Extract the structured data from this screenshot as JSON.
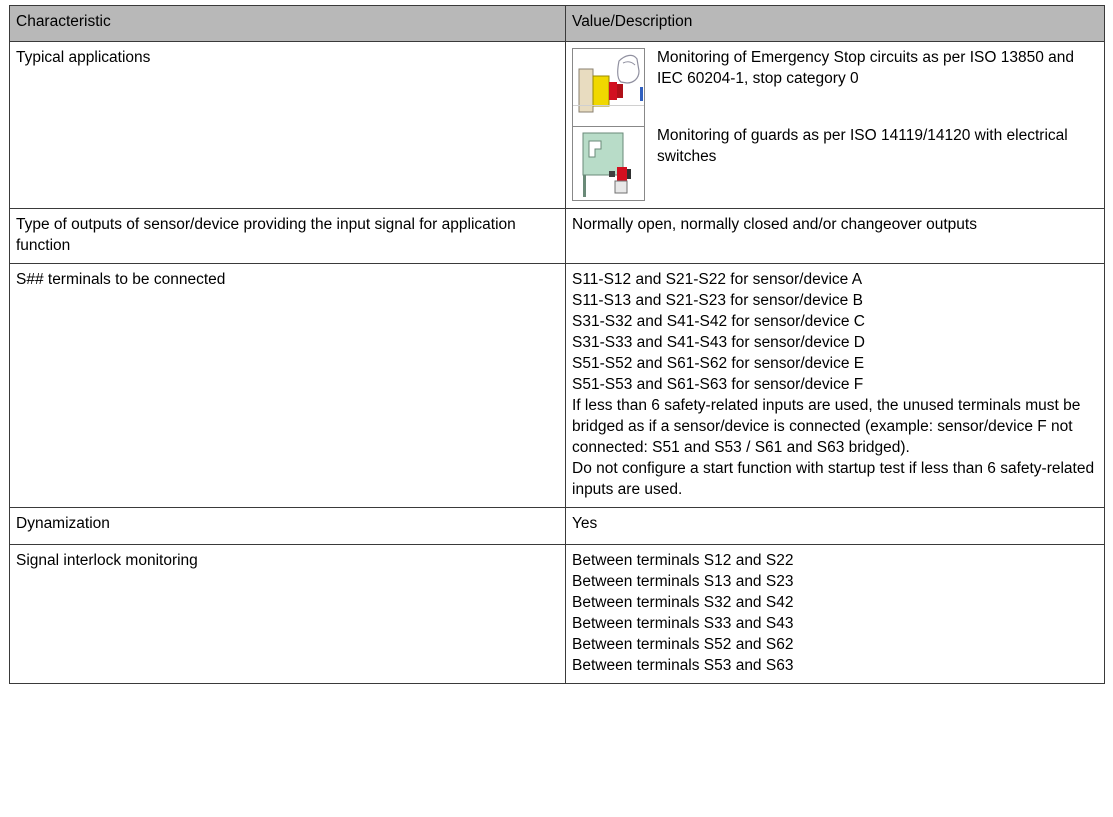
{
  "table": {
    "headers": [
      "Characteristic",
      "Value/Description"
    ],
    "rows": {
      "typical_applications": {
        "label": "Typical applications",
        "items": [
          {
            "icon": "emergency-stop-button-icon",
            "text": "Monitoring of Emergency Stop circuits as per ISO 13850 and IEC 60204-1, stop category 0"
          },
          {
            "icon": "guard-switch-icon",
            "text": "Monitoring of guards as per ISO 14119/14120 with electrical switches"
          }
        ]
      },
      "output_type": {
        "label": "Type of outputs of sensor/device providing the input signal for application function",
        "value": "Normally open, normally closed and/or changeover outputs"
      },
      "terminals": {
        "label": "S## terminals to be connected",
        "lines": [
          "S11-S12 and S21-S22 for sensor/device A",
          "S11-S13 and S21-S23 for sensor/device B",
          "S31-S32 and S41-S42 for sensor/device C",
          "S31-S33 and S41-S43 for sensor/device D",
          "S51-S52 and S61-S62 for sensor/device E",
          "S51-S53 and S61-S63 for sensor/device F",
          "If less than 6 safety-related inputs are used, the unused terminals must be bridged as if a sensor/device is connected (example: sensor/device F not connected: S51 and S53 / S61 and S63 bridged).",
          "Do not configure a start function with startup test if less than 6 safety-related inputs are used."
        ]
      },
      "dynamization": {
        "label": "Dynamization",
        "value": "Yes"
      },
      "interlock": {
        "label": "Signal interlock monitoring",
        "lines": [
          "Between terminals S12 and S22",
          "Between terminals S13 and S23",
          "Between terminals S32 and S42",
          "Between terminals S33 and S43",
          "Between terminals S52 and S62",
          "Between terminals S53 and S63"
        ]
      }
    }
  }
}
